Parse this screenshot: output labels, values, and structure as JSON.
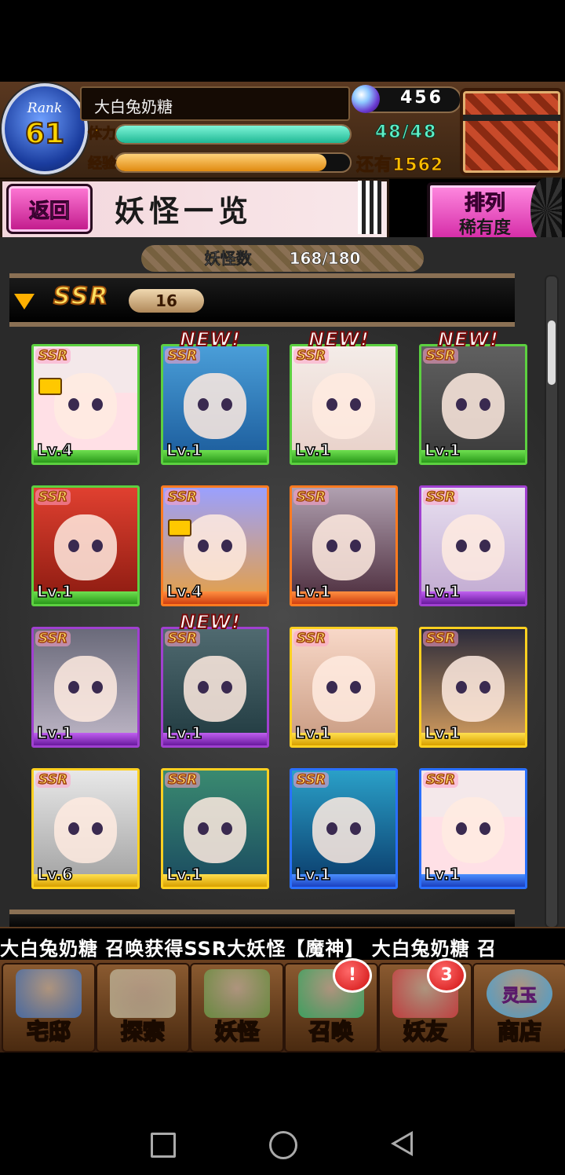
{
  "player": {
    "rank_label": "Rank",
    "rank": "61",
    "name": "大白兔奶糖",
    "gems": "456",
    "stamina_label": "体力",
    "stamina_value": "48/48",
    "stamina_fraction": 1.0,
    "exp_label": "经验",
    "exp_remaining": "还有1562",
    "exp_fraction": 0.9
  },
  "toolbar": {
    "back_label": "返回",
    "title": "妖怪一览",
    "sort_title": "排列",
    "sort_value": "稀有度"
  },
  "collection": {
    "count_label": "妖怪数",
    "count_value": "168/180"
  },
  "ssr_section": {
    "tag": "SSR",
    "count": "16"
  },
  "cards": [
    {
      "badge": "SSR",
      "level": "Lv.4",
      "frame": "green",
      "new": "",
      "locked": true
    },
    {
      "badge": "SSR",
      "level": "Lv.1",
      "frame": "green",
      "new": "NEW!",
      "locked": false
    },
    {
      "badge": "SSR",
      "level": "Lv.1",
      "frame": "green",
      "new": "NEW!",
      "locked": false
    },
    {
      "badge": "SSR",
      "level": "Lv.1",
      "frame": "green",
      "new": "NEW!",
      "locked": false
    },
    {
      "badge": "SSR",
      "level": "Lv.1",
      "frame": "green",
      "new": "",
      "locked": false
    },
    {
      "badge": "SSR",
      "level": "Lv.4",
      "frame": "orange",
      "new": "",
      "locked": true
    },
    {
      "badge": "SSR",
      "level": "Lv.1",
      "frame": "orange",
      "new": "",
      "locked": false
    },
    {
      "badge": "SSR",
      "level": "Lv.1",
      "frame": "purple",
      "new": "",
      "locked": false
    },
    {
      "badge": "SSR",
      "level": "Lv.1",
      "frame": "purple",
      "new": "",
      "locked": false
    },
    {
      "badge": "SSR",
      "level": "Lv.1",
      "frame": "purple",
      "new": "NEW!",
      "locked": false
    },
    {
      "badge": "SSR",
      "level": "Lv.1",
      "frame": "yellow",
      "new": "",
      "locked": false
    },
    {
      "badge": "SSR",
      "level": "Lv.1",
      "frame": "yellow",
      "new": "",
      "locked": false
    },
    {
      "badge": "SSR",
      "level": "Lv.6",
      "frame": "yellow",
      "new": "",
      "locked": false
    },
    {
      "badge": "SSR",
      "level": "Lv.1",
      "frame": "yellow",
      "new": "",
      "locked": false
    },
    {
      "badge": "SSR",
      "level": "Lv.1",
      "frame": "blue",
      "new": "",
      "locked": false
    },
    {
      "badge": "SSR",
      "level": "Lv.1",
      "frame": "blue",
      "new": "",
      "locked": false
    }
  ],
  "ticker": {
    "text": "大白兔奶糖 召唤获得SSR大妖怪【魔神】   大白兔奶糖 召"
  },
  "nav": [
    {
      "label": "宅邸",
      "icon": "mansion-icon",
      "badge": ""
    },
    {
      "label": "探索",
      "icon": "magnifier-map-icon",
      "badge": ""
    },
    {
      "label": "妖怪",
      "icon": "scroll-icon",
      "badge": ""
    },
    {
      "label": "召唤",
      "icon": "pentagram-icon",
      "badge": "!"
    },
    {
      "label": "妖友",
      "icon": "friend-icon",
      "badge": "3"
    },
    {
      "label": "商店",
      "icon": "spirit-orb-icon",
      "badge": "",
      "orb_text": "灵玉"
    }
  ]
}
